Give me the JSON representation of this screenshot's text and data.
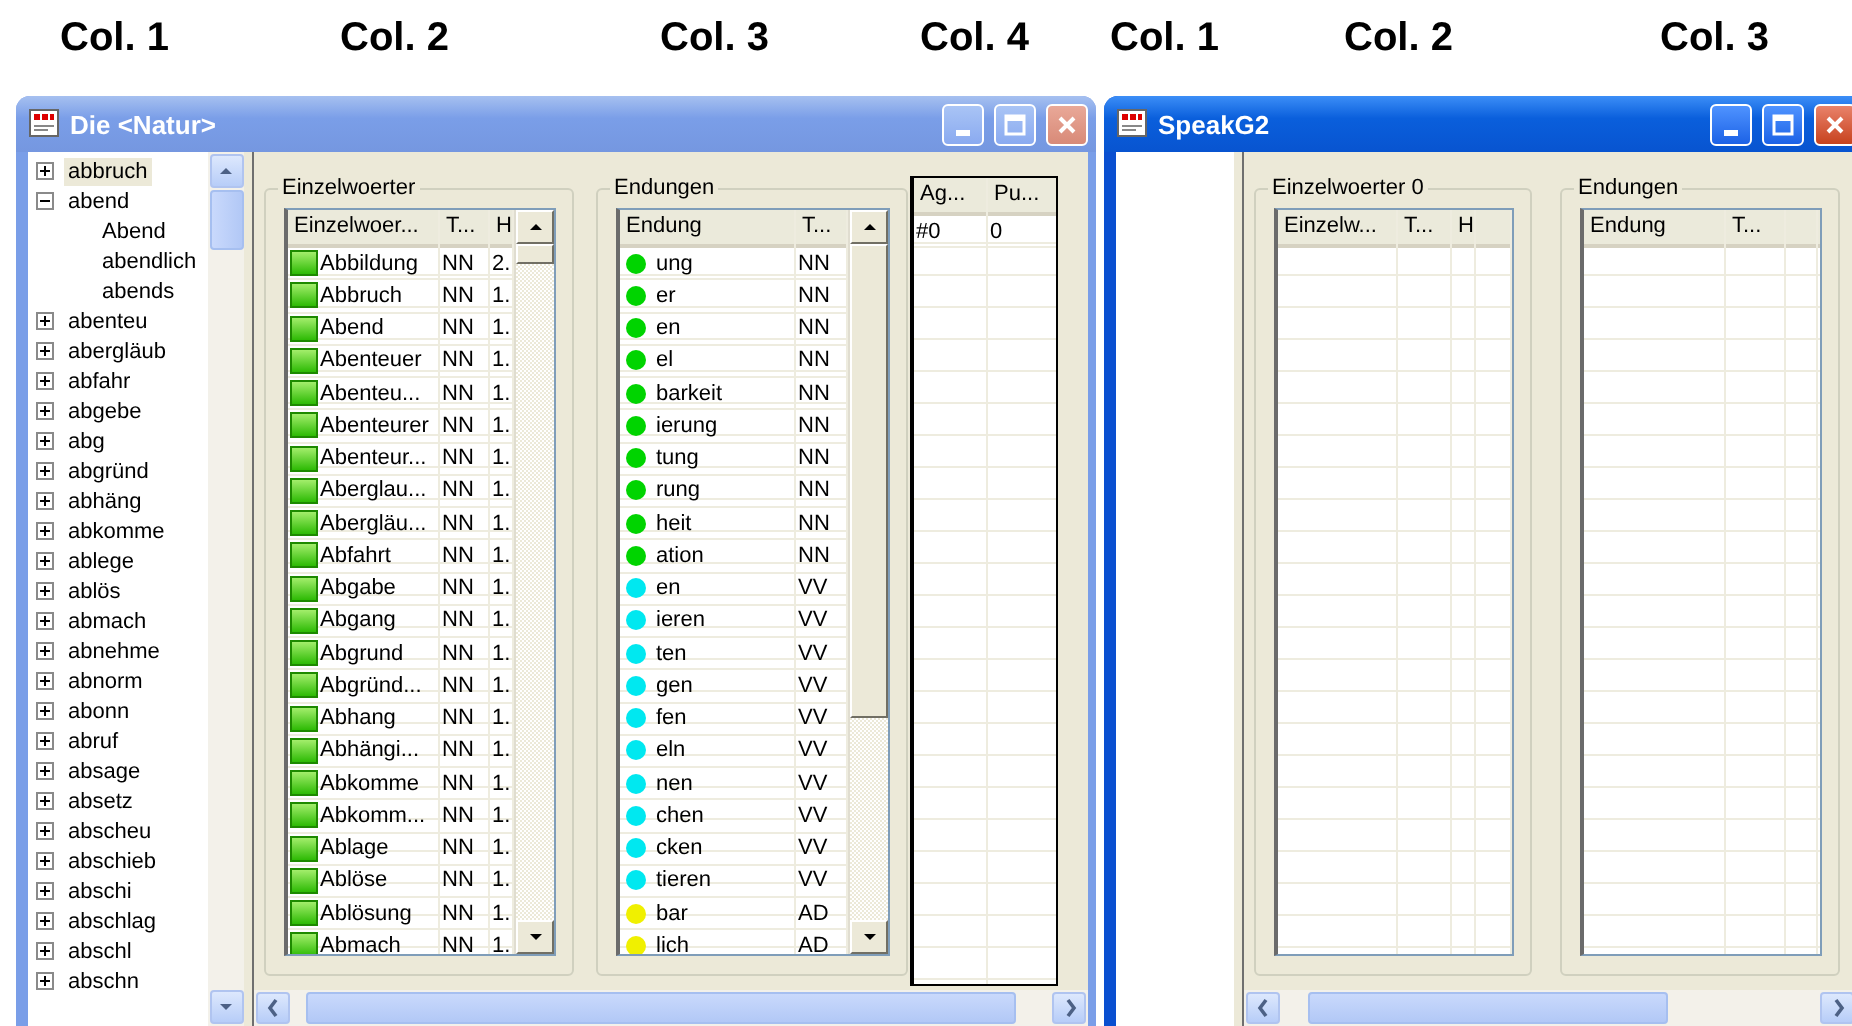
{
  "column_labels": [
    "Col. 1",
    "Col. 2",
    "Col. 3",
    "Col. 4",
    "Col. 1",
    "Col. 2",
    "Col. 3"
  ],
  "windows": [
    {
      "title": "Die <Natur>",
      "active": false,
      "tree": {
        "items": [
          {
            "label": "abbruch",
            "selected": true,
            "expanded": false
          },
          {
            "label": "abend",
            "selected": false,
            "expanded": true,
            "children": [
              {
                "label": "Abend",
                "selected": false
              },
              {
                "label": "abendlich",
                "selected": false
              },
              {
                "label": "abends",
                "selected": false
              }
            ]
          },
          {
            "label": "abenteu",
            "selected": false,
            "expanded": false
          },
          {
            "label": "abergläub",
            "selected": false,
            "expanded": false
          },
          {
            "label": "abfahr",
            "selected": false,
            "expanded": false
          },
          {
            "label": "abgebe",
            "selected": false,
            "expanded": false
          },
          {
            "label": "abg",
            "selected": false,
            "expanded": false
          },
          {
            "label": "abgründ",
            "selected": false,
            "expanded": false
          },
          {
            "label": "abhäng",
            "selected": false,
            "expanded": false
          },
          {
            "label": "abkomme",
            "selected": false,
            "expanded": false
          },
          {
            "label": "ablege",
            "selected": false,
            "expanded": false
          },
          {
            "label": "ablös",
            "selected": false,
            "expanded": false
          },
          {
            "label": "abmach",
            "selected": false,
            "expanded": false
          },
          {
            "label": "abnehme",
            "selected": false,
            "expanded": false
          },
          {
            "label": "abnorm",
            "selected": false,
            "expanded": false
          },
          {
            "label": "abonn",
            "selected": false,
            "expanded": false
          },
          {
            "label": "abruf",
            "selected": false,
            "expanded": false
          },
          {
            "label": "absage",
            "selected": false,
            "expanded": false
          },
          {
            "label": "absetz",
            "selected": false,
            "expanded": false
          },
          {
            "label": "abscheu",
            "selected": false,
            "expanded": false
          },
          {
            "label": "abschieb",
            "selected": false,
            "expanded": false
          },
          {
            "label": "abschi",
            "selected": false,
            "expanded": false
          },
          {
            "label": "abschlag",
            "selected": false,
            "expanded": false
          },
          {
            "label": "abschl",
            "selected": false,
            "expanded": false
          },
          {
            "label": "abschn",
            "selected": false,
            "expanded": false
          }
        ]
      },
      "einzelwoerter": {
        "title": "Einzelwoerter",
        "columns": [
          "Einzelwoer...",
          "T...",
          "H"
        ],
        "rows": [
          [
            "Abbildung",
            "NN",
            "2."
          ],
          [
            "Abbruch",
            "NN",
            "1."
          ],
          [
            "Abend",
            "NN",
            "1."
          ],
          [
            "Abenteuer",
            "NN",
            "1."
          ],
          [
            "Abenteu...",
            "NN",
            "1."
          ],
          [
            "Abenteurer",
            "NN",
            "1."
          ],
          [
            "Abenteur...",
            "NN",
            "1."
          ],
          [
            "Aberglau...",
            "NN",
            "1."
          ],
          [
            "Abergläu...",
            "NN",
            "1."
          ],
          [
            "Abfahrt",
            "NN",
            "1."
          ],
          [
            "Abgabe",
            "NN",
            "1."
          ],
          [
            "Abgang",
            "NN",
            "1."
          ],
          [
            "Abgrund",
            "NN",
            "1."
          ],
          [
            "Abgründ...",
            "NN",
            "1."
          ],
          [
            "Abhang",
            "NN",
            "1."
          ],
          [
            "Abhängi...",
            "NN",
            "1."
          ],
          [
            "Abkomme",
            "NN",
            "1."
          ],
          [
            "Abkomm...",
            "NN",
            "1."
          ],
          [
            "Ablage",
            "NN",
            "1."
          ],
          [
            "Ablöse",
            "NN",
            "1."
          ],
          [
            "Ablösung",
            "NN",
            "1."
          ],
          [
            "Abmach",
            "NN",
            "1."
          ]
        ]
      },
      "endungen": {
        "title": "Endungen",
        "columns": [
          "Endung",
          "T..."
        ],
        "rows": [
          {
            "cells": [
              "ung",
              "NN"
            ],
            "color": "#00d400"
          },
          {
            "cells": [
              "er",
              "NN"
            ],
            "color": "#00d400"
          },
          {
            "cells": [
              "en",
              "NN"
            ],
            "color": "#00d400"
          },
          {
            "cells": [
              "el",
              "NN"
            ],
            "color": "#00d400"
          },
          {
            "cells": [
              "barkeit",
              "NN"
            ],
            "color": "#00d400"
          },
          {
            "cells": [
              "ierung",
              "NN"
            ],
            "color": "#00d400"
          },
          {
            "cells": [
              "tung",
              "NN"
            ],
            "color": "#00d400"
          },
          {
            "cells": [
              "rung",
              "NN"
            ],
            "color": "#00d400"
          },
          {
            "cells": [
              "heit",
              "NN"
            ],
            "color": "#00d400"
          },
          {
            "cells": [
              "ation",
              "NN"
            ],
            "color": "#00d400"
          },
          {
            "cells": [
              "en",
              "VV"
            ],
            "color": "#00e8f0"
          },
          {
            "cells": [
              "ieren",
              "VV"
            ],
            "color": "#00e8f0"
          },
          {
            "cells": [
              "ten",
              "VV"
            ],
            "color": "#00e8f0"
          },
          {
            "cells": [
              "gen",
              "VV"
            ],
            "color": "#00e8f0"
          },
          {
            "cells": [
              "fen",
              "VV"
            ],
            "color": "#00e8f0"
          },
          {
            "cells": [
              "eln",
              "VV"
            ],
            "color": "#00e8f0"
          },
          {
            "cells": [
              "nen",
              "VV"
            ],
            "color": "#00e8f0"
          },
          {
            "cells": [
              "chen",
              "VV"
            ],
            "color": "#00e8f0"
          },
          {
            "cells": [
              "cken",
              "VV"
            ],
            "color": "#00e8f0"
          },
          {
            "cells": [
              "tieren",
              "VV"
            ],
            "color": "#00e8f0"
          },
          {
            "cells": [
              "bar",
              "AD"
            ],
            "color": "#f0f000"
          },
          {
            "cells": [
              "lich",
              "AD"
            ],
            "color": "#f0f000"
          }
        ]
      },
      "list": {
        "columns": [
          "Ag...",
          "Pu..."
        ],
        "rows": [
          [
            "#0",
            "0"
          ]
        ]
      }
    },
    {
      "title": "SpeakG2",
      "active": true,
      "einzelwoerter": {
        "title": "Einzelwoerter 0",
        "columns": [
          "Einzelw...",
          "T...",
          "H"
        ]
      },
      "endungen": {
        "title": "Endungen",
        "columns": [
          "Endung",
          "T..."
        ]
      }
    }
  ]
}
